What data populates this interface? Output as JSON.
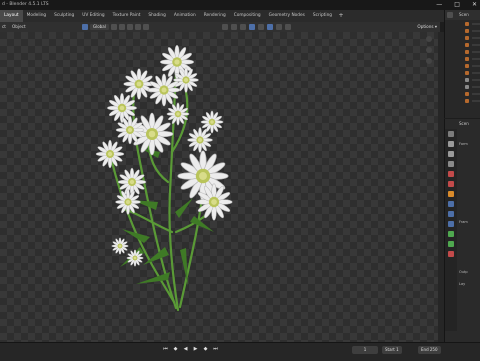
{
  "window": {
    "title": "d - Blender 4.5.1 LTS"
  },
  "window_buttons": [
    "—",
    "□",
    "✕"
  ],
  "workspace_tabs": [
    {
      "label": "Layout",
      "active": true
    },
    {
      "label": "Modeling"
    },
    {
      "label": "Sculpting"
    },
    {
      "label": "UV Editing"
    },
    {
      "label": "Texture Paint"
    },
    {
      "label": "Shading"
    },
    {
      "label": "Animation"
    },
    {
      "label": "Rendering"
    },
    {
      "label": "Compositing"
    },
    {
      "label": "Geometry Nodes"
    },
    {
      "label": "Scripting"
    }
  ],
  "add_workspace": "+",
  "viewport_header": {
    "menus": [
      "ct",
      "Object"
    ],
    "orientation": "Global",
    "options": "Options ▾"
  },
  "outliner": {
    "title": "Scen"
  },
  "properties": {
    "title": "Scen",
    "row1": "Form",
    "row2": "Fram",
    "row3": "Outp",
    "row4": "Lay"
  },
  "timeline": {
    "start_label": "Start",
    "start_value": "1",
    "end_label": "End",
    "end_value": "250",
    "current": "1"
  },
  "colors": {
    "accent": "#4d6fa8",
    "object_icon": "#b6692d",
    "flower_white": "#ececec",
    "flower_center": "#c9d06a",
    "stem": "#5a9a36"
  }
}
